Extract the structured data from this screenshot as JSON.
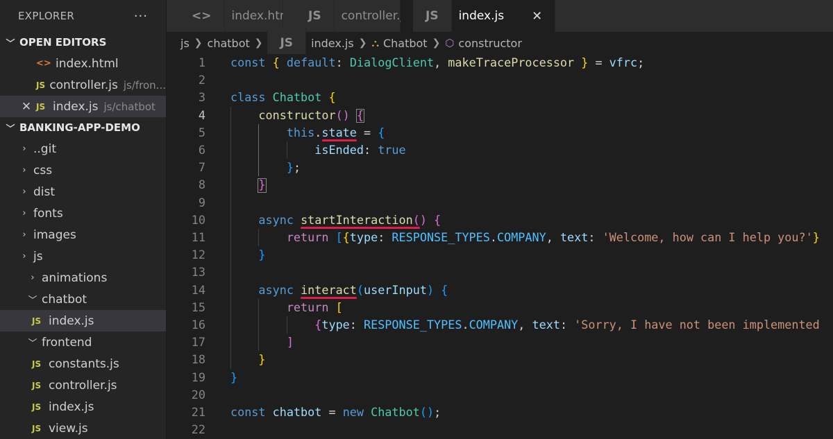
{
  "sidebar": {
    "title": "EXPLORER",
    "more": "···",
    "open_editors": {
      "label": "OPEN EDITORS",
      "items": [
        {
          "icon": "<>",
          "name": "index.html",
          "desc": ""
        },
        {
          "icon": "JS",
          "name": "controller.js",
          "desc": "js/fron..."
        },
        {
          "icon": "JS",
          "name": "index.js",
          "desc": "js/chatbot"
        }
      ]
    },
    "project": {
      "label": "BANKING-APP-DEMO",
      "items": [
        {
          "name": "..git"
        },
        {
          "name": "css"
        },
        {
          "name": "dist"
        },
        {
          "name": "fonts"
        },
        {
          "name": "images"
        },
        {
          "name": "js"
        },
        {
          "name": "animations"
        },
        {
          "name": "chatbot"
        },
        {
          "name": "index.js"
        },
        {
          "name": "frontend"
        },
        {
          "name": "constants.js"
        },
        {
          "name": "controller.js"
        },
        {
          "name": "index.js"
        },
        {
          "name": "view.js"
        }
      ]
    }
  },
  "tabs": [
    {
      "icon": "<>",
      "label": "index.html"
    },
    {
      "icon": "JS",
      "label": "controller.js"
    },
    {
      "icon": "JS",
      "label": "index.js",
      "close": "✕"
    }
  ],
  "breadcrumb": {
    "parts": [
      "js",
      "chatbot",
      "index.js",
      "Chatbot",
      "constructor"
    ],
    "js_icon": "JS"
  },
  "editor": {
    "current_line": 4,
    "line_numbers": [
      "1",
      "2",
      "3",
      "4",
      "5",
      "6",
      "7",
      "8",
      "9",
      "10",
      "11",
      "12",
      "13",
      "14",
      "15",
      "16",
      "17",
      "18",
      "19",
      "20",
      "21",
      "22"
    ],
    "lines": [
      "const { default: DialogClient, makeTraceProcessor } = vfrc;",
      "",
      "class Chatbot {",
      "    constructor() {",
      "        this.state = {",
      "            isEnded: true",
      "        };",
      "    }",
      "",
      "    async startInteraction() {",
      "        return [{type: RESPONSE_TYPES.COMPANY, text: 'Welcome, how can I help you?'}",
      "    }",
      "",
      "    async interact(userInput) {",
      "        return [",
      "            {type: RESPONSE_TYPES.COMPANY, text: 'Sorry, I have not been implemented",
      "        ]",
      "    }",
      "}",
      "",
      "const chatbot = new Chatbot();",
      ""
    ]
  },
  "colors": {
    "keyword": "#569cd6",
    "control": "#c586c0",
    "function": "#dcdcaa",
    "class": "#4ec9b0",
    "variable": "#9cdcfe",
    "constant": "#4fc1ff",
    "string": "#ce9178",
    "underline": "#e01e4b"
  }
}
